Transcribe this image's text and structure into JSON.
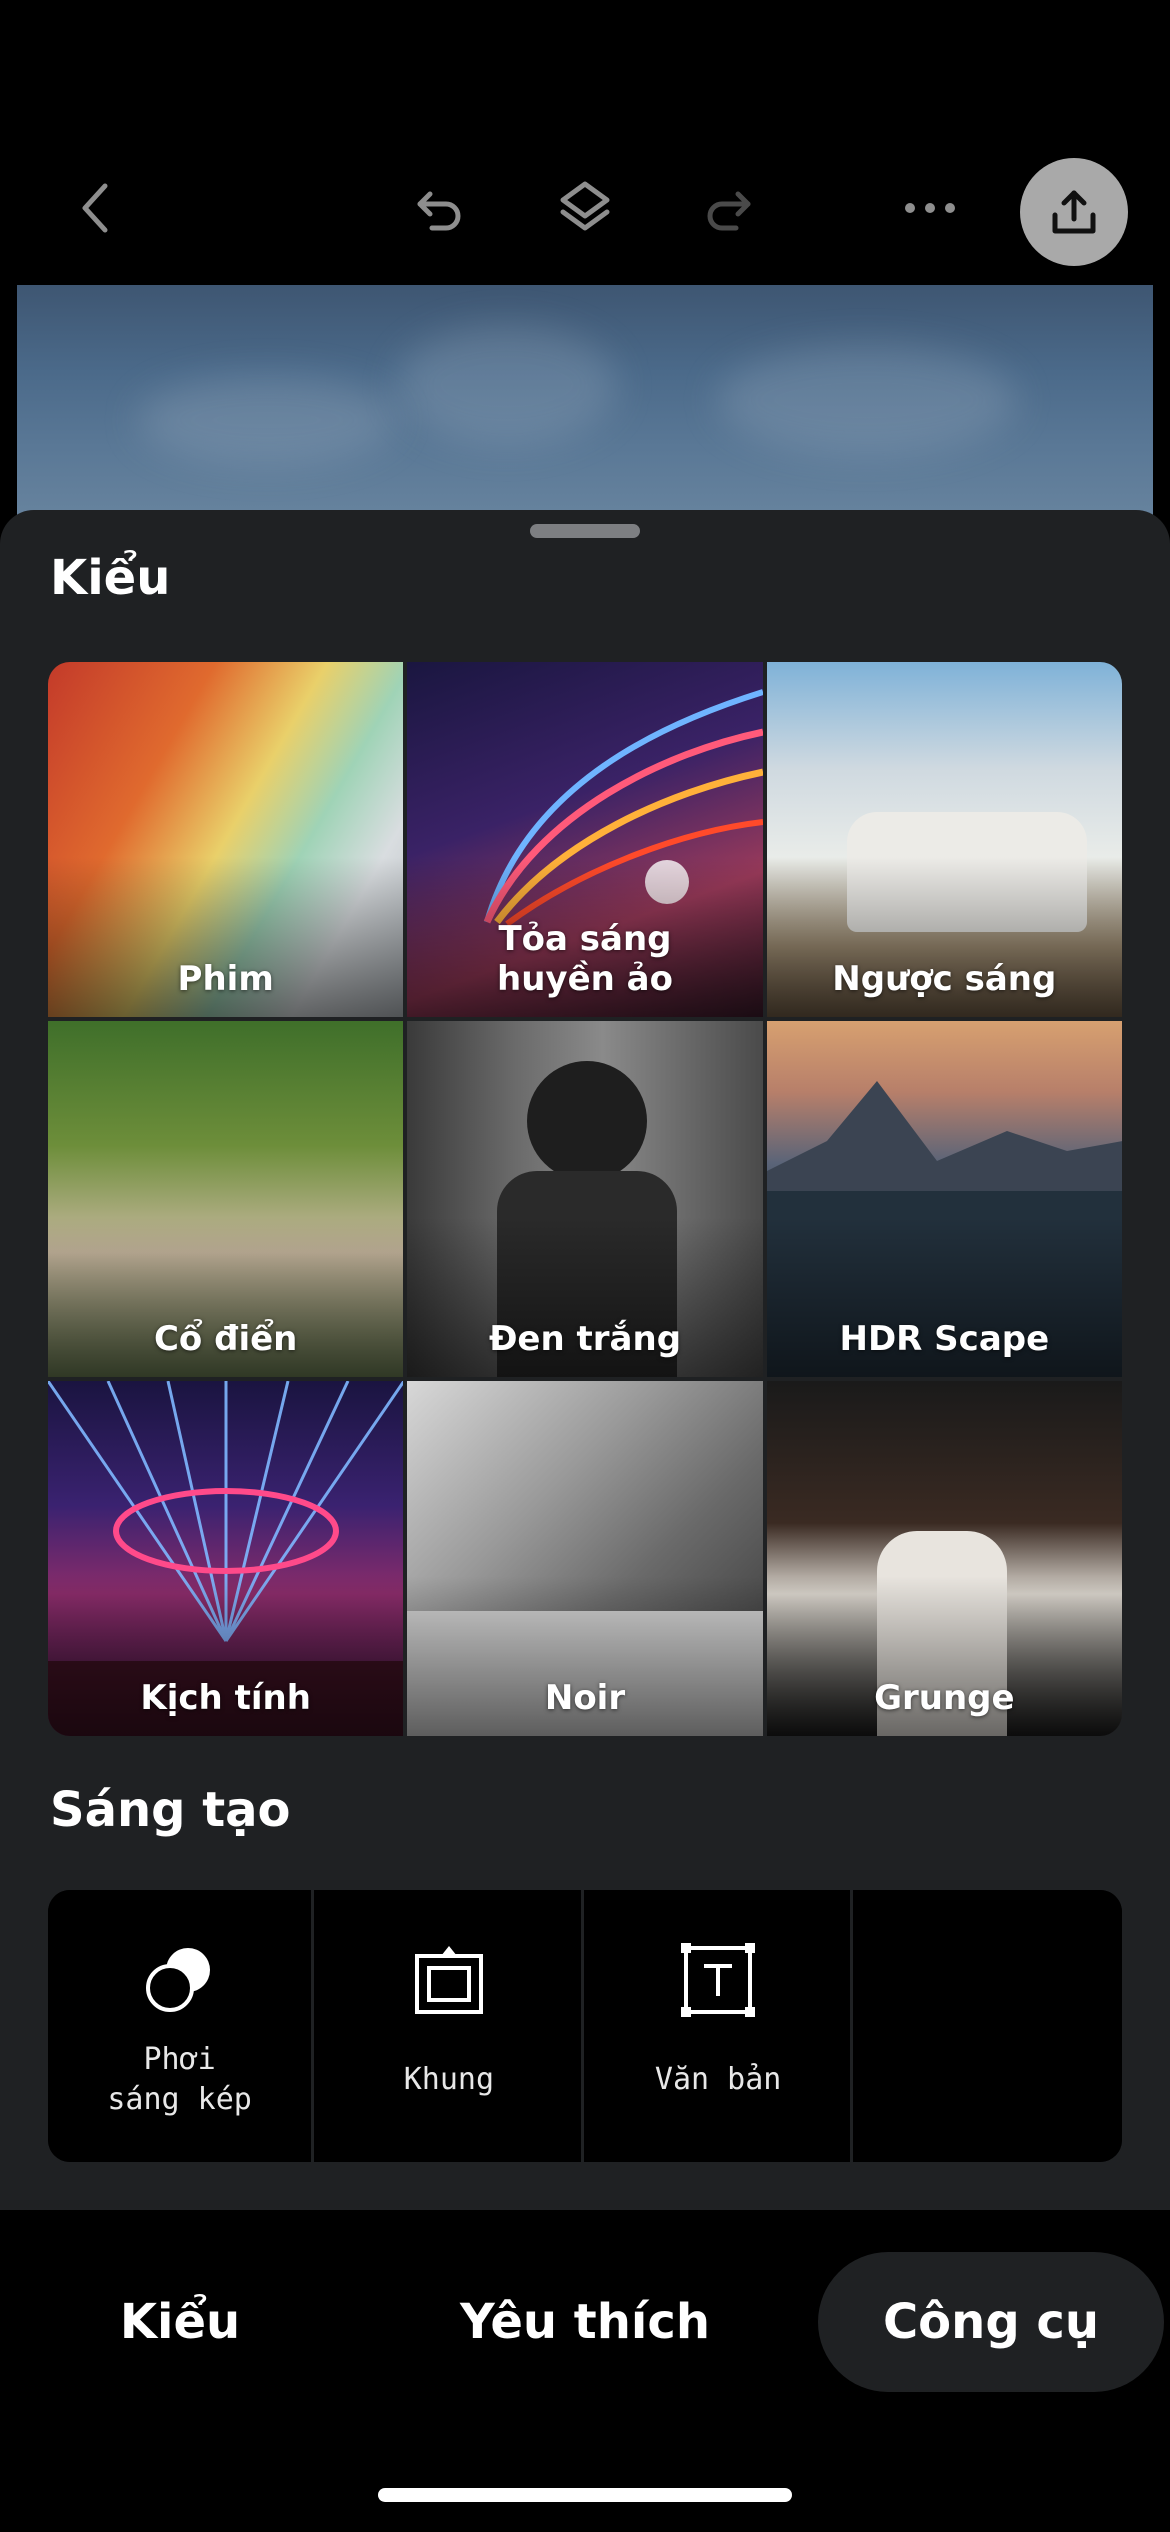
{
  "toolbar": {
    "icons": [
      "back-icon",
      "undo-icon",
      "layers-icon",
      "redo-icon",
      "more-icon",
      "export-icon"
    ]
  },
  "sheet": {
    "styles_title": "Kiểu",
    "styles": [
      {
        "label": "Phim"
      },
      {
        "label": "Tỏa sáng\nhuyền ảo"
      },
      {
        "label": "Ngược sáng"
      },
      {
        "label": "Cổ điển"
      },
      {
        "label": "Đen trắng"
      },
      {
        "label": "HDR Scape"
      },
      {
        "label": "Kịch tính"
      },
      {
        "label": "Noir"
      },
      {
        "label": "Grunge"
      }
    ],
    "creative_title": "Sáng tạo",
    "tools": [
      {
        "label": "Phơi\nsáng kép",
        "icon": "double-exposure-icon"
      },
      {
        "label": "Khung",
        "icon": "frame-icon"
      },
      {
        "label": "Văn bản",
        "icon": "text-icon"
      },
      {
        "label": ""
      }
    ]
  },
  "tabs": {
    "styles": "Kiểu",
    "favorites": "Yêu thích",
    "tools": "Công cụ",
    "active": "tools"
  },
  "colors": {
    "background": "#000000",
    "sheet": "#1f2123",
    "export_button": "#a9a9a9",
    "icon_muted": "#8e8e8e"
  }
}
